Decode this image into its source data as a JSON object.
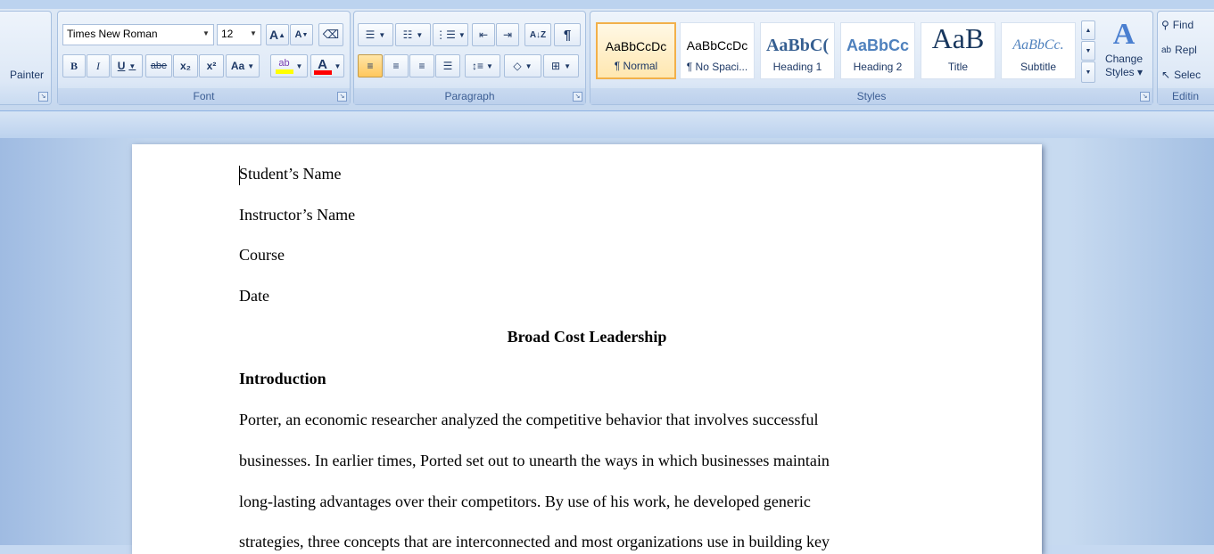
{
  "clipboard": {
    "painter_label": "Painter"
  },
  "font": {
    "group_label": "Font",
    "name": "Times New Roman",
    "size": "12",
    "bold": "B",
    "italic": "I",
    "underline": "U",
    "strike": "abe",
    "subscript": "x₂",
    "superscript": "x²",
    "case": "Aa",
    "grow": "A",
    "shrink": "A"
  },
  "paragraph": {
    "group_label": "Paragraph",
    "sort": "A↓Z",
    "pilcrow": "¶"
  },
  "styles": {
    "group_label": "Styles",
    "items": [
      {
        "sample": "AaBbCcDc",
        "name": "¶ Normal"
      },
      {
        "sample": "AaBbCcDc",
        "name": "¶ No Spaci..."
      },
      {
        "sample": "AaBbC(",
        "name": "Heading 1"
      },
      {
        "sample": "AaBbCc",
        "name": "Heading 2"
      },
      {
        "sample": "AaB",
        "name": "Title"
      },
      {
        "sample": "AaBbCc.",
        "name": "Subtitle"
      }
    ],
    "change_styles_line1": "Change",
    "change_styles_line2": "Styles ▾"
  },
  "editing": {
    "group_label": "Editin",
    "find": "Find",
    "replace": "Repl",
    "select": "Selec"
  },
  "colors": {
    "highlight": "#ffff00",
    "font_color": "#ff0000",
    "active_style_border": "#f2b04a"
  },
  "document": {
    "lines": [
      "Student’s Name",
      "Instructor’s Name",
      "Course",
      "Date"
    ],
    "title": "Broad Cost Leadership",
    "heading": "Introduction",
    "body": [
      "Porter, an economic researcher analyzed the competitive behavior that involves successful",
      "businesses. In earlier times, Ported set out to unearth the ways in which businesses maintain",
      "long-lasting advantages over their competitors. By use of his work, he developed generic",
      "strategies, three concepts that are interconnected and most organizations use in building key"
    ]
  }
}
